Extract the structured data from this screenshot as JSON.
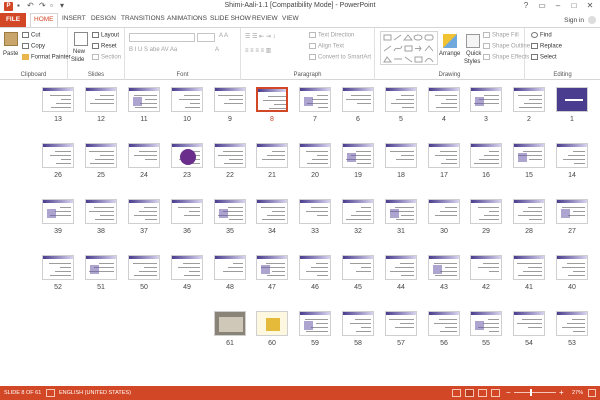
{
  "window": {
    "title": "Shimi-Aali-1.1 [Compatibility Mode] - PowerPoint",
    "app_icon": "P",
    "controls": [
      "?",
      "▭",
      "–",
      "□",
      "✕"
    ]
  },
  "ribbon_tabs": {
    "file": "FILE",
    "tabs": [
      "HOME",
      "INSERT",
      "DESIGN",
      "TRANSITIONS",
      "ANIMATIONS",
      "SLIDE SHOW",
      "REVIEW",
      "VIEW"
    ],
    "active": "HOME",
    "sign_in": "Sign in"
  },
  "ribbon": {
    "clipboard": {
      "label": "Clipboard",
      "paste": "Paste",
      "cut": "Cut",
      "copy": "Copy",
      "format_painter": "Format Painter"
    },
    "slides": {
      "label": "Slides",
      "new_slide": "New",
      "new_slide_2": "Slide",
      "layout": "Layout",
      "reset": "Reset",
      "section": "Section"
    },
    "font": {
      "label": "Font"
    },
    "paragraph": {
      "label": "Paragraph",
      "text_direction": "Text Direction",
      "align_text": "Align Text",
      "convert_smartart": "Convert to SmartArt"
    },
    "drawing": {
      "label": "Drawing",
      "arrange": "Arrange",
      "quick_styles": "Quick",
      "quick_styles_2": "Styles",
      "shape_fill": "Shape Fill",
      "shape_outline": "Shape Outline",
      "shape_effects": "Shape Effects"
    },
    "editing": {
      "label": "Editing",
      "find": "Find",
      "replace": "Replace",
      "select": "Select"
    }
  },
  "slides": {
    "total": 61,
    "selected": 8,
    "rows": [
      [
        1,
        2,
        3,
        4,
        5,
        6,
        7,
        8,
        9,
        10,
        11,
        12,
        13
      ],
      [
        14,
        15,
        16,
        17,
        18,
        19,
        20,
        21,
        22,
        23,
        24,
        25,
        26
      ],
      [
        27,
        28,
        29,
        30,
        31,
        32,
        33,
        34,
        35,
        36,
        37,
        38,
        39
      ],
      [
        40,
        41,
        42,
        43,
        44,
        45,
        46,
        47,
        48,
        49,
        50,
        51,
        52
      ],
      [
        53,
        54,
        55,
        56,
        57,
        58,
        59,
        60,
        61
      ]
    ],
    "labels": {
      "1": "1",
      "2": "2",
      "3": "3",
      "4": "4",
      "5": "5",
      "6": "6",
      "7": "7",
      "8": "8",
      "9": "9",
      "10": "10",
      "11": "11",
      "12": "12",
      "13": "13",
      "14": "14",
      "15": "15",
      "16": "16",
      "17": "17",
      "18": "18",
      "19": "19",
      "20": "20",
      "21": "21",
      "22": "22",
      "23": "23",
      "24": "24",
      "25": "25",
      "26": "26",
      "27": "27",
      "28": "28",
      "29": "29",
      "30": "30",
      "31": "31",
      "32": "32",
      "33": "33",
      "34": "34",
      "35": "35",
      "36": "36",
      "37": "37",
      "38": "38",
      "39": "39",
      "40": "40",
      "41": "41",
      "42": "42",
      "43": "43",
      "44": "44",
      "45": "45",
      "46": "46",
      "47": "47",
      "48": "48",
      "49": "49",
      "50": "50",
      "51": "51",
      "52": "52",
      "53": "53",
      "54": "54",
      "55": "55",
      "56": "56",
      "57": "57",
      "58": "58",
      "59": "59",
      "60": "60",
      "61": "61"
    }
  },
  "status_bar": {
    "slide_info": "SLIDE 8 OF 61",
    "language": "ENGLISH (UNITED STATES)",
    "zoom": "27%"
  },
  "colors": {
    "accent": "#d24726",
    "slide_band": "#4a3d8f"
  }
}
